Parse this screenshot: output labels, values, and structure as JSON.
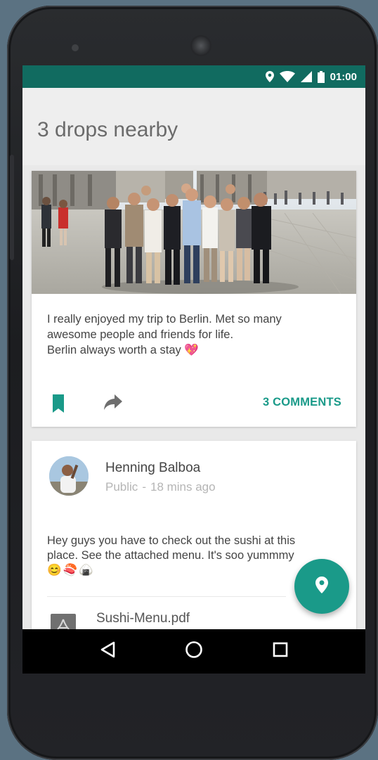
{
  "status_bar": {
    "time": "01:00",
    "icons": [
      "location-icon",
      "wifi-icon",
      "signal-icon",
      "battery-icon"
    ]
  },
  "header": {
    "title": "3 drops nearby"
  },
  "posts": [
    {
      "image": "group-photo",
      "text_lines": [
        "I really enjoyed my trip to Berlin. Met so many",
        "awesome people and friends for life.",
        "Berlin always worth a stay"
      ],
      "emoji": "💖",
      "actions": {
        "bookmark_icon": "bookmark-icon",
        "share_icon": "share-icon",
        "comments_label": "3 COMMENTS"
      }
    },
    {
      "author": "Henning Balboa",
      "visibility": "Public",
      "separator": "-",
      "time": "18 mins ago",
      "text_lines": [
        "Hey guys you have to check out the sushi at this",
        "place. See the attached menu. It's soo yummmy"
      ],
      "emojis": [
        "😊",
        "🍣",
        "🍙"
      ],
      "attachment": {
        "name": "Sushi-Menu.pdf",
        "icon": "pdf-icon"
      }
    }
  ],
  "fab": {
    "icon": "location-icon"
  },
  "navbar": {
    "items": [
      "back-icon",
      "home-icon",
      "recents-icon"
    ]
  },
  "colors": {
    "status_bar": "#116b60",
    "accent": "#1a9a89",
    "page_bg": "#5b7282"
  }
}
